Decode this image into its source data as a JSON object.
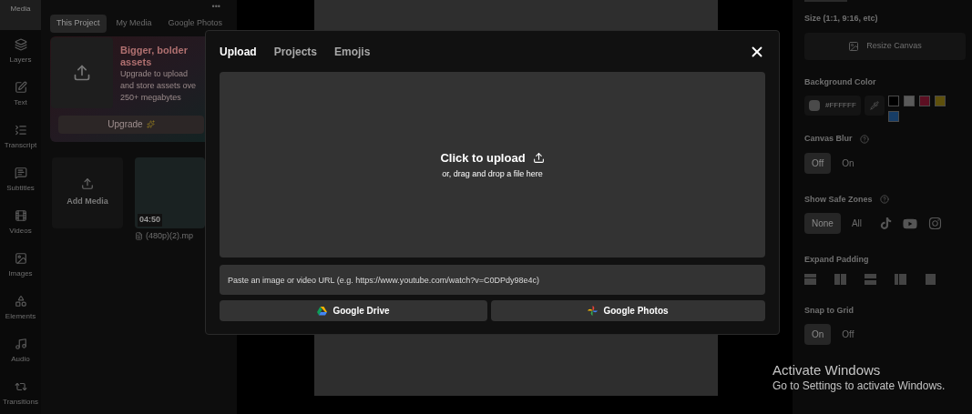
{
  "rail": [
    {
      "label": "Media",
      "selected": true
    },
    {
      "label": "Layers",
      "selected": false
    },
    {
      "label": "Text",
      "selected": false
    },
    {
      "label": "Transcript",
      "selected": false
    },
    {
      "label": "Subtitles",
      "selected": false
    },
    {
      "label": "Videos",
      "selected": false
    },
    {
      "label": "Images",
      "selected": false
    },
    {
      "label": "Elements",
      "selected": false
    },
    {
      "label": "Audio",
      "selected": false
    },
    {
      "label": "Transitions",
      "selected": false
    }
  ],
  "media_panel": {
    "menu": "•••",
    "tabs": [
      {
        "label": "This Project",
        "selected": true
      },
      {
        "label": "My Media",
        "selected": false
      },
      {
        "label": "Google Photos",
        "selected": false
      }
    ],
    "promo": {
      "title": "Bigger, bolder assets",
      "lines": [
        "Upgrade to upload",
        "and store assets ove",
        "250+ megabytes"
      ],
      "button": "Upgrade"
    },
    "add_media": "Add Media",
    "clips": [
      {
        "duration": "04:50",
        "filename": "(480p)(2).mp"
      }
    ]
  },
  "settings": {
    "size": {
      "label": "Size (1:1, 9:16, etc)",
      "button": "Resize Canvas"
    },
    "background_color": {
      "label": "Background Color",
      "value": "#FFFFFF",
      "presets": [
        {
          "color": "#000000"
        },
        {
          "color": "#5a5a5a"
        },
        {
          "color": "#5c0f22"
        },
        {
          "color": "#5e500c"
        },
        {
          "color": "#173d66"
        }
      ]
    },
    "canvas_blur": {
      "label": "Canvas Blur",
      "options": [
        {
          "label": "Off",
          "selected": true
        },
        {
          "label": "On",
          "selected": false
        }
      ]
    },
    "safe_zones": {
      "label": "Show Safe Zones",
      "options": [
        {
          "label": "None",
          "selected": true
        },
        {
          "label": "All",
          "selected": false
        }
      ]
    },
    "expand_padding": {
      "label": "Expand Padding"
    },
    "snap_to_grid": {
      "label": "Snap to Grid",
      "options": [
        {
          "label": "On",
          "selected": true
        },
        {
          "label": "Off",
          "selected": false
        }
      ]
    }
  },
  "upload_dialog": {
    "tabs": [
      {
        "label": "Upload",
        "selected": true
      },
      {
        "label": "Projects",
        "selected": false
      },
      {
        "label": "Emojis",
        "selected": false
      }
    ],
    "dropzone": {
      "title": "Click to upload",
      "subtitle": "or, drag and drop a file here"
    },
    "url_placeholder": "Paste an image or video URL (e.g. https://www.youtube.com/watch?v=C0DPdy98e4c)",
    "buttons": [
      {
        "label": "Google Drive",
        "kind": "drive"
      },
      {
        "label": "Google Photos",
        "kind": "photos"
      }
    ]
  },
  "os_notice": {
    "title": "Activate Windows",
    "subtitle": "Go to Settings to activate Windows."
  }
}
